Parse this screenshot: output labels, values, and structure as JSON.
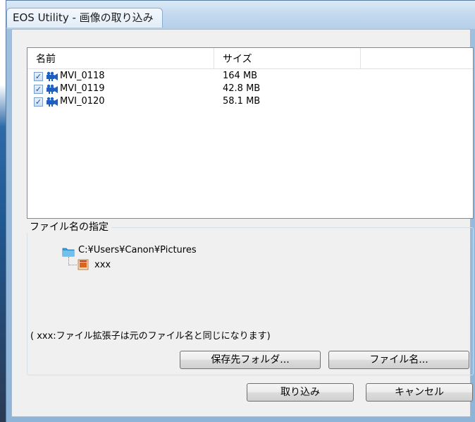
{
  "window": {
    "title": "EOS Utility - 画像の取り込み"
  },
  "list": {
    "columns": [
      "名前",
      "サイズ",
      ""
    ],
    "rows": [
      {
        "name": "MVI_0118",
        "size": "164 MB",
        "checked": true
      },
      {
        "name": "MVI_0119",
        "size": "42.8 MB",
        "checked": true
      },
      {
        "name": "MVI_0120",
        "size": "58.1 MB",
        "checked": true
      }
    ]
  },
  "filename_group": {
    "label": "ファイル名の指定",
    "folder_path": "C:¥Users¥Canon¥Pictures",
    "file_name": "xxx",
    "note": "( xxx:ファイル拡張子は元のファイル名と同じになります)"
  },
  "buttons": {
    "destination_folder": "保存先フォルダ...",
    "file_name": "ファイル名...",
    "import": "取り込み",
    "cancel": "キャンセル"
  },
  "icons": {
    "movie": "movie-camera-icon",
    "folder": "folder-icon",
    "file": "file-icon",
    "check": "checkbox-checked"
  },
  "colors": {
    "accent": "#1c4f9a",
    "movie_icon": "#1f5fbf",
    "folder": "#3a9bd8",
    "file": "#d9651f"
  }
}
